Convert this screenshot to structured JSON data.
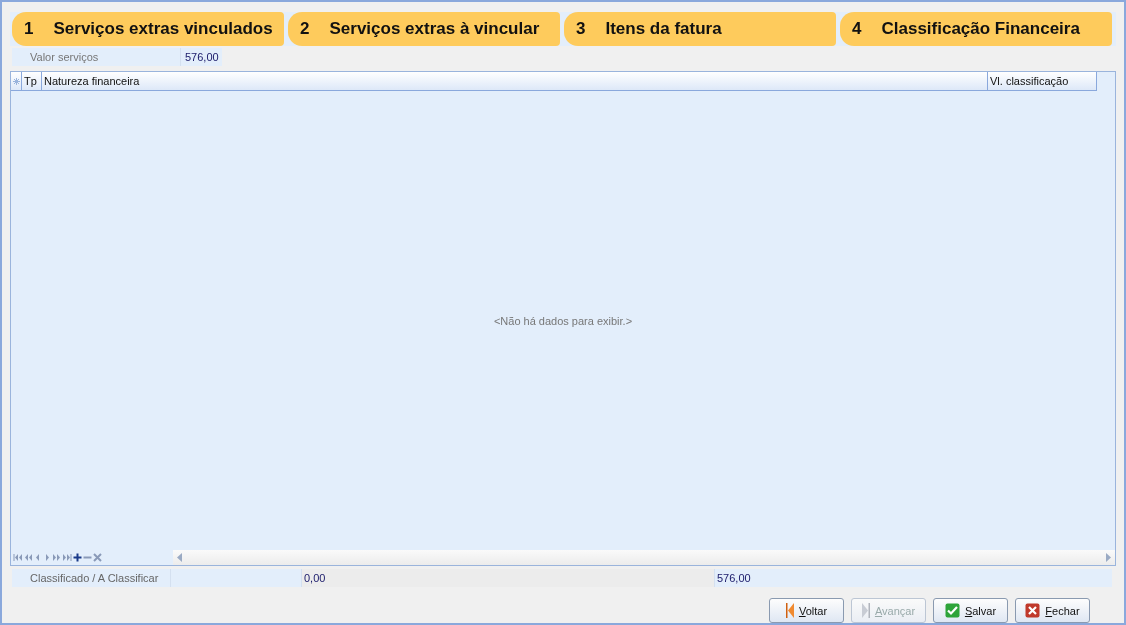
{
  "steps": [
    {
      "number": "1",
      "label": "Serviços extras vinculados"
    },
    {
      "number": "2",
      "label": "Serviços extras à vincular"
    },
    {
      "number": "3",
      "label": "Itens da fatura"
    },
    {
      "number": "4",
      "label": "Classificação Financeira"
    }
  ],
  "valor_servicos": {
    "label": "Valor serviços",
    "value": "576,00"
  },
  "grid": {
    "columns": [
      "Tp",
      "Natureza financeira",
      "Vl. classificação"
    ],
    "empty_text": "<Não há dados para exibir.>"
  },
  "summary": {
    "label": "Classificado / A Classificar",
    "classified": "0,00",
    "to_classify": "576,00"
  },
  "buttons": [
    {
      "kind": "back",
      "label": "Voltar",
      "disabled": false
    },
    {
      "kind": "next",
      "label": "Avançar",
      "disabled": true
    },
    {
      "kind": "save",
      "label": "Salvar",
      "disabled": false
    },
    {
      "kind": "close",
      "label": "Fechar",
      "disabled": false
    }
  ]
}
